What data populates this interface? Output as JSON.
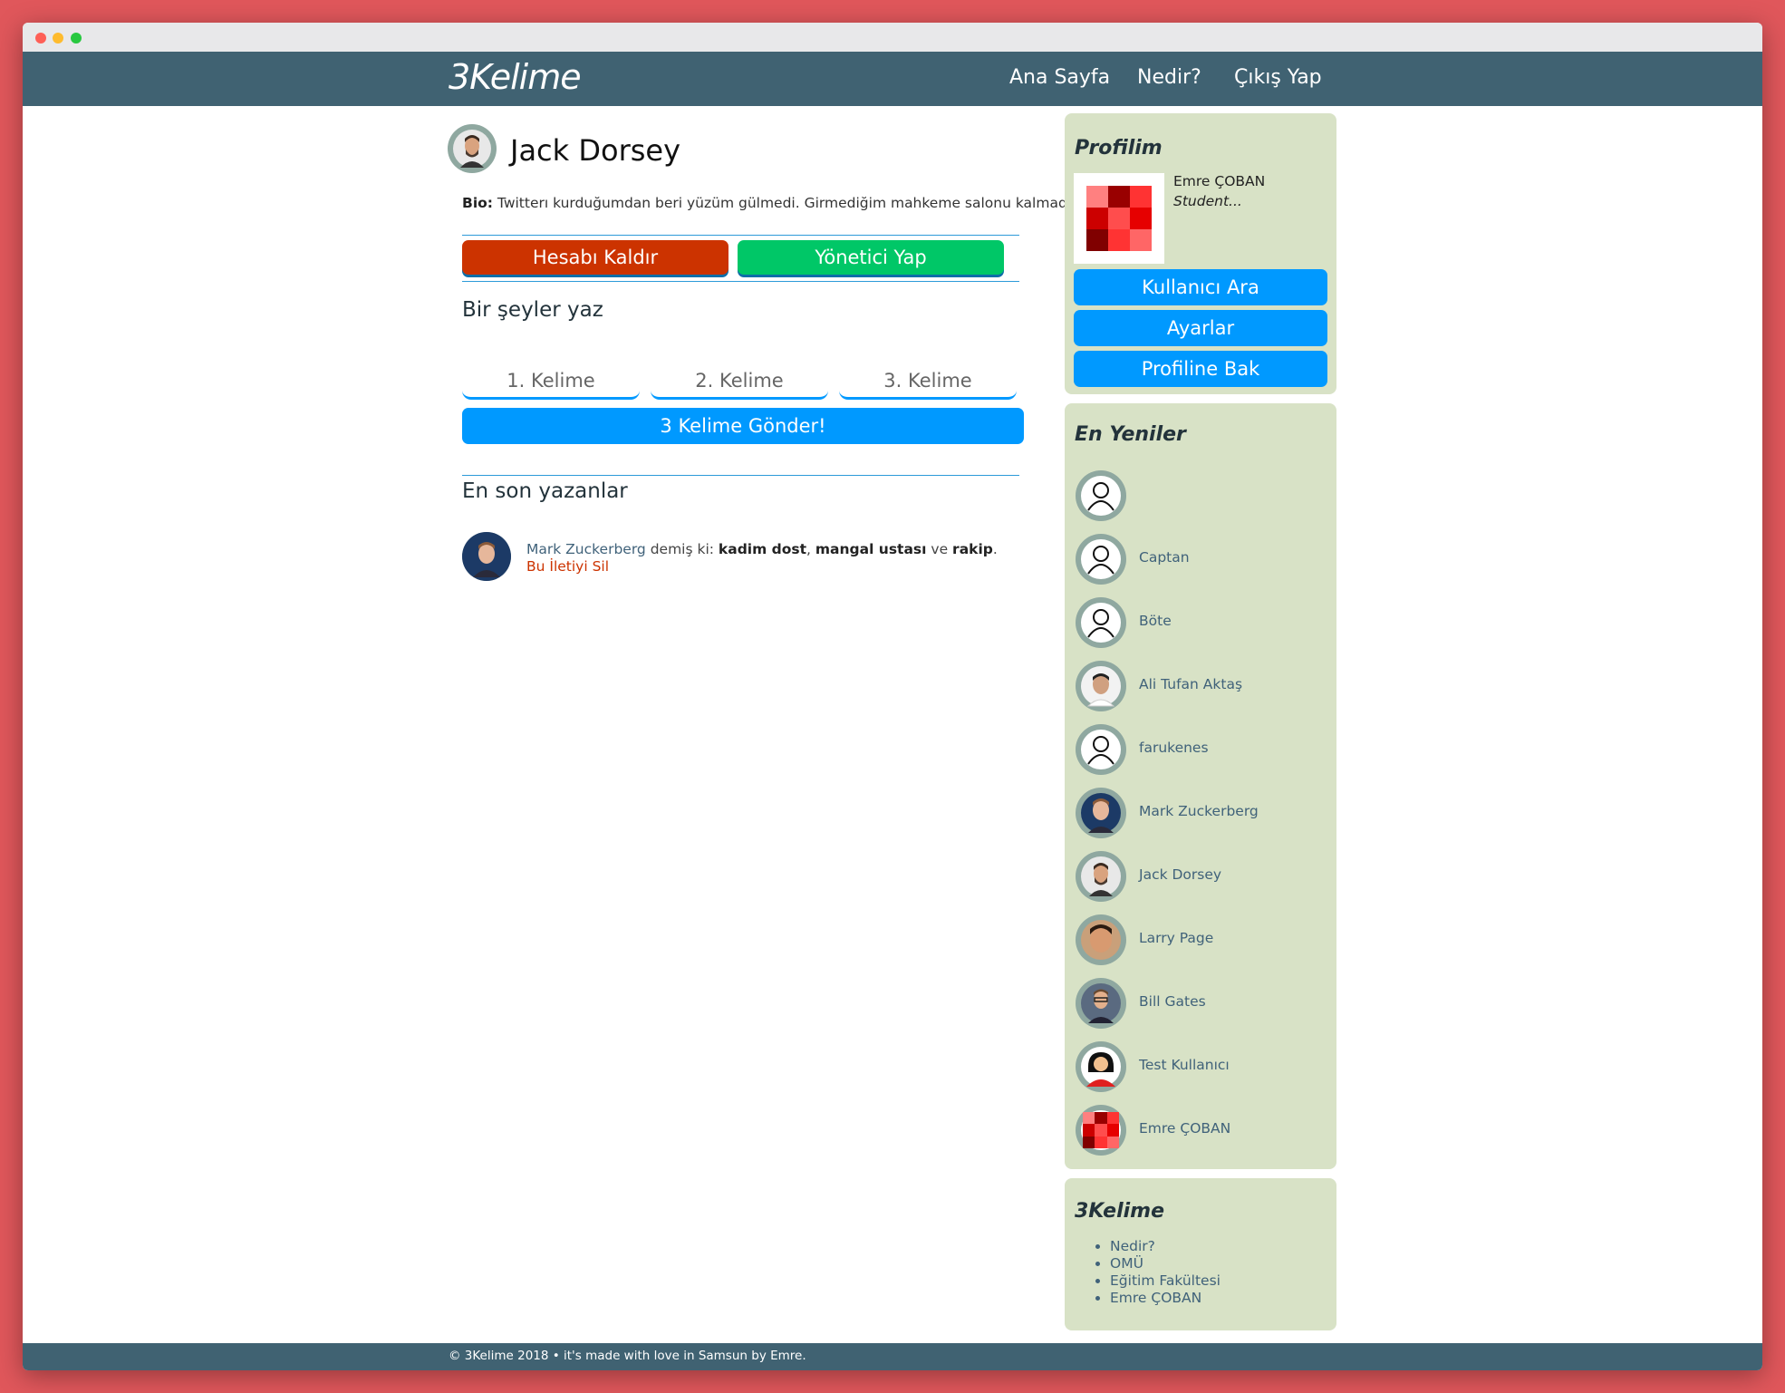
{
  "nav": {
    "brand": "3Kelime",
    "links": [
      "Ana Sayfa",
      "Nedir?",
      "Çıkış Yap"
    ]
  },
  "profile": {
    "name": "Jack Dorsey",
    "bio_label": "Bio:",
    "bio_text": " Twitterı kurduğumdan beri yüzüm gülmedi. Girmediğim mahkeme salonu kalmadı.",
    "remove_button": "Hesabı Kaldır",
    "admin_button": "Yönetici Yap"
  },
  "compose": {
    "title": "Bir şeyler yaz",
    "word1_placeholder": "1. Kelime",
    "word2_placeholder": "2. Kelime",
    "word3_placeholder": "3. Kelime",
    "submit_button": "3 Kelime Gönder!"
  },
  "latest": {
    "title": "En son yazanlar",
    "post": {
      "author": "Mark Zuckerberg",
      "said": " demiş ki: ",
      "word1": "kadim dost",
      "sep1": ", ",
      "word2": "mangal ustası",
      "sep2": " ve ",
      "word3": "rakip",
      "end": ".",
      "delete_link": "Bu İletiyi Sil"
    }
  },
  "sidebar": {
    "profile": {
      "title": "Profilim",
      "name": "Emre ÇOBAN",
      "bio": "Student...",
      "buttons": [
        "Kullanıcı Ara",
        "Ayarlar",
        "Profiline Bak"
      ]
    },
    "newest": {
      "title": "En Yeniler",
      "users": [
        "",
        "Captan",
        "Böte",
        "Ali Tufan Aktaş",
        "farukenes",
        "Mark Zuckerberg",
        "Jack Dorsey",
        "Larry Page",
        "Bill Gates",
        "Test Kullanıcı",
        "Emre ÇOBAN"
      ]
    },
    "about": {
      "title": "3Kelime",
      "links": [
        "Nedir?",
        "OMÜ",
        "Eğitim Fakültesi",
        "Emre ÇOBAN"
      ]
    }
  },
  "footer": {
    "text": "© 3Kelime 2018 • it's made with love in Samsun by Emre."
  },
  "colors": {
    "navbar": "#406272",
    "accent_blue": "#0099ff",
    "danger": "#cc3300",
    "success": "#00c767",
    "sidebar_panel": "#d8e2c6"
  }
}
